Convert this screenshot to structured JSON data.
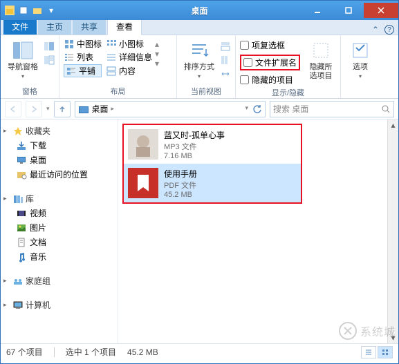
{
  "window": {
    "title": "桌面"
  },
  "tabs": {
    "t1": "文件",
    "t2": "主页",
    "t3": "共享",
    "t4": "查看"
  },
  "ribbon": {
    "nav_pane": "导航窗格",
    "group_pane": "窗格",
    "medium_icons": "中图标",
    "small_icons": "小图标",
    "list": "列表",
    "details": "详细信息",
    "tiles": "平铺",
    "content": "内容",
    "group_layout": "布局",
    "sort_by": "排序方式",
    "current_view": "当前视图",
    "item_checkboxes": "项复选框",
    "filename_ext": "文件扩展名",
    "hidden_items": "隐藏的项目",
    "hide_selected": "隐藏所\n选项目",
    "group_showhide": "显示/隐藏",
    "options": "选项"
  },
  "address": {
    "location": "桌面",
    "search_placeholder": "搜索 桌面"
  },
  "nav": {
    "favorites": "收藏夹",
    "downloads": "下载",
    "desktop": "桌面",
    "recent": "最近访问的位置",
    "libraries": "库",
    "videos": "视频",
    "pictures": "图片",
    "documents": "文档",
    "music": "音乐",
    "homegroup": "家庭组",
    "computer": "计算机"
  },
  "files": [
    {
      "name": "蓝又时-孤单心事",
      "type": "MP3 文件",
      "size": "7.16 MB"
    },
    {
      "name": "使用手册",
      "type": "PDF 文件",
      "size": "45.2 MB"
    }
  ],
  "status": {
    "total": "67 个项目",
    "selection": "选中 1 个项目",
    "size": "45.2 MB"
  },
  "watermark": "系统城"
}
